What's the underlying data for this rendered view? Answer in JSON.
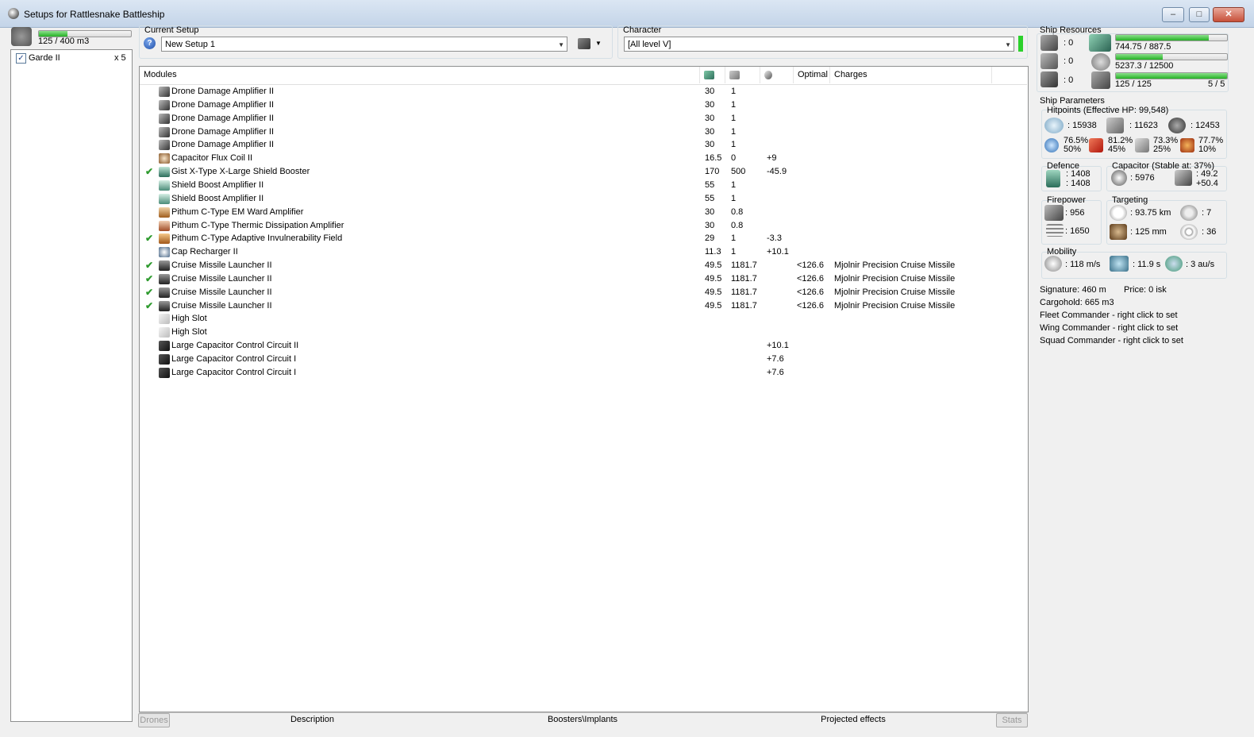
{
  "window": {
    "title": "Setups for Rattlesnake Battleship",
    "buttons": [
      "minimize",
      "maximize",
      "close"
    ]
  },
  "drones": {
    "capacity_text": "125 / 400 m3",
    "capacity_fraction": 0.3125,
    "items": [
      {
        "name": "Garde II",
        "checked": true,
        "count": "x 5"
      }
    ]
  },
  "setup": {
    "label": "Current Setup",
    "selected": "New Setup 1"
  },
  "character": {
    "label": "Character",
    "selected": "[All level V]"
  },
  "modules": {
    "columns": [
      "Modules",
      "",
      "",
      "",
      "Optimal",
      "Charges"
    ],
    "rows": [
      {
        "name": "Drone Damage Amplifier II",
        "active": false,
        "icon": "drone-damage-amplifier-icon",
        "c1": "30",
        "c2": "1",
        "c3": "",
        "opt": "",
        "charges": ""
      },
      {
        "name": "Drone Damage Amplifier II",
        "active": false,
        "icon": "drone-damage-amplifier-icon",
        "c1": "30",
        "c2": "1",
        "c3": "",
        "opt": "",
        "charges": ""
      },
      {
        "name": "Drone Damage Amplifier II",
        "active": false,
        "icon": "drone-damage-amplifier-icon",
        "c1": "30",
        "c2": "1",
        "c3": "",
        "opt": "",
        "charges": ""
      },
      {
        "name": "Drone Damage Amplifier II",
        "active": false,
        "icon": "drone-damage-amplifier-icon",
        "c1": "30",
        "c2": "1",
        "c3": "",
        "opt": "",
        "charges": ""
      },
      {
        "name": "Drone Damage Amplifier II",
        "active": false,
        "icon": "drone-damage-amplifier-icon",
        "c1": "30",
        "c2": "1",
        "c3": "",
        "opt": "",
        "charges": ""
      },
      {
        "name": "Capacitor Flux Coil II",
        "active": false,
        "icon": "capacitor-flux-coil-icon",
        "c1": "16.5",
        "c2": "0",
        "c3": "+9",
        "opt": "",
        "charges": ""
      },
      {
        "name": "Gist X-Type X-Large Shield Booster",
        "active": true,
        "icon": "shield-booster-icon",
        "c1": "170",
        "c2": "500",
        "c3": "-45.9",
        "opt": "",
        "charges": ""
      },
      {
        "name": "Shield Boost Amplifier II",
        "active": false,
        "icon": "shield-boost-amplifier-icon",
        "c1": "55",
        "c2": "1",
        "c3": "",
        "opt": "",
        "charges": ""
      },
      {
        "name": "Shield Boost Amplifier II",
        "active": false,
        "icon": "shield-boost-amplifier-icon",
        "c1": "55",
        "c2": "1",
        "c3": "",
        "opt": "",
        "charges": ""
      },
      {
        "name": "Pithum C-Type EM Ward Amplifier",
        "active": false,
        "icon": "ward-amplifier-icon",
        "c1": "30",
        "c2": "0.8",
        "c3": "",
        "opt": "",
        "charges": ""
      },
      {
        "name": "Pithum C-Type Thermic Dissipation Amplifier",
        "active": false,
        "icon": "dissipation-amplifier-icon",
        "c1": "30",
        "c2": "0.8",
        "c3": "",
        "opt": "",
        "charges": ""
      },
      {
        "name": "Pithum C-Type Adaptive Invulnerability Field",
        "active": true,
        "icon": "invulnerability-field-icon",
        "c1": "29",
        "c2": "1",
        "c3": "-3.3",
        "opt": "",
        "charges": ""
      },
      {
        "name": "Cap Recharger II",
        "active": false,
        "icon": "cap-recharger-icon",
        "c1": "11.3",
        "c2": "1",
        "c3": "+10.1",
        "opt": "",
        "charges": ""
      },
      {
        "name": "Cruise Missile Launcher II",
        "active": true,
        "icon": "missile-launcher-icon",
        "c1": "49.5",
        "c2": "1181.7",
        "c3": "",
        "opt": "<126.6",
        "charges": "Mjolnir Precision Cruise Missile"
      },
      {
        "name": "Cruise Missile Launcher II",
        "active": true,
        "icon": "missile-launcher-icon",
        "c1": "49.5",
        "c2": "1181.7",
        "c3": "",
        "opt": "<126.6",
        "charges": "Mjolnir Precision Cruise Missile"
      },
      {
        "name": "Cruise Missile Launcher II",
        "active": true,
        "icon": "missile-launcher-icon",
        "c1": "49.5",
        "c2": "1181.7",
        "c3": "",
        "opt": "<126.6",
        "charges": "Mjolnir Precision Cruise Missile"
      },
      {
        "name": "Cruise Missile Launcher II",
        "active": true,
        "icon": "missile-launcher-icon",
        "c1": "49.5",
        "c2": "1181.7",
        "c3": "",
        "opt": "<126.6",
        "charges": "Mjolnir Precision Cruise Missile"
      },
      {
        "name": "High Slot",
        "active": false,
        "icon": "empty-high-slot-icon",
        "c1": "",
        "c2": "",
        "c3": "",
        "opt": "",
        "charges": ""
      },
      {
        "name": "High Slot",
        "active": false,
        "icon": "empty-high-slot-icon",
        "c1": "",
        "c2": "",
        "c3": "",
        "opt": "",
        "charges": ""
      },
      {
        "name": "Large Capacitor Control Circuit II",
        "active": false,
        "icon": "rig-icon",
        "c1": "",
        "c2": "",
        "c3": "+10.1",
        "opt": "",
        "charges": ""
      },
      {
        "name": "Large Capacitor Control Circuit I",
        "active": false,
        "icon": "rig-icon",
        "c1": "",
        "c2": "",
        "c3": "+7.6",
        "opt": "",
        "charges": ""
      },
      {
        "name": "Large Capacitor Control Circuit I",
        "active": false,
        "icon": "rig-icon",
        "c1": "",
        "c2": "",
        "c3": "+7.6",
        "opt": "",
        "charges": ""
      }
    ]
  },
  "bottom_tabs": [
    "Drones",
    "Description",
    "Boosters\\Implants",
    "Projected effects",
    "Stats"
  ],
  "resources": {
    "label": "Ship Resources",
    "hardpoints": [
      ":  0",
      ":  0",
      ":  0"
    ],
    "cpu": {
      "text": "744.75 / 887.5",
      "fraction": 0.839
    },
    "powergrid": {
      "text": "5237.3 / 12500",
      "fraction": 0.419
    },
    "drone_bw": {
      "text": "125 / 125",
      "fraction": 1.0
    },
    "drones_out": "5 / 5"
  },
  "params": {
    "label": "Ship Parameters",
    "hitpoints_label": "Hitpoints (Effective HP: 99,548)",
    "shield_hp": ": 15938",
    "armor_hp": ": 11623",
    "hull_hp": ": 12453",
    "resists": [
      {
        "top": "76.5%",
        "bottom": "50%"
      },
      {
        "top": "81.2%",
        "bottom": "45%"
      },
      {
        "top": "73.3%",
        "bottom": "25%"
      },
      {
        "top": "77.7%",
        "bottom": "10%"
      }
    ],
    "defence_label": "Defence",
    "defence_top": ": 1408",
    "defence_bottom": ": 1408",
    "capacitor_label": "Capacitor (Stable at: 37%)",
    "cap_amount": ": 5976",
    "cap_top": ": 49.2",
    "cap_bottom": "+50.4",
    "firepower_label": "Firepower",
    "dps": ": 956",
    "volley": ": 1650",
    "targeting_label": "Targeting",
    "range": ": 93.75 km",
    "max_targets": ": 7",
    "scan_res": ": 125 mm",
    "sensor": ": 36",
    "mobility_label": "Mobility",
    "speed": ": 118 m/s",
    "align": ": 11.9 s",
    "warp": ": 3 au/s"
  },
  "info": [
    "Signature: 460 m",
    "Price: 0 isk",
    "Cargohold: 665 m3",
    "Fleet Commander - right click to set",
    "Wing Commander - right click to set",
    "Squad Commander - right click to set"
  ]
}
